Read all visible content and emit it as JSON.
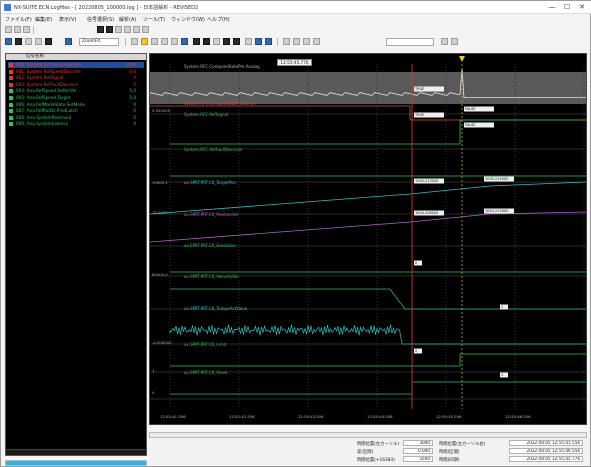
{
  "window": {
    "title": "NX-SUITE ECN Logfiles - [ 20220805_100000.log ] - 日本語解析 - REVISED2",
    "min": "—",
    "max": "☐",
    "close": "✕"
  },
  "menu": [
    "ファイル(F)",
    "編集(E)",
    "表示(V)",
    "信号選択(S)",
    "解析(A)",
    "ツール(T)",
    "ウィンドウ(W)",
    "ヘルプ(H)"
  ],
  "toolbar": {
    "combo_value": "ZoomFit"
  },
  "signal_list": {
    "header": "信号名称",
    "items": [
      {
        "name": "000: System.RefComputeState",
        "value": "1000",
        "color": "#ff3030",
        "selected": true
      },
      {
        "name": "001: System.RefSpeedDiscrete",
        "value": "0.0",
        "color": "#ff3030"
      },
      {
        "name": "002: System.RefSignal",
        "value": "0",
        "color": "#d63b3b"
      },
      {
        "name": "003: System.RefFaultDecision",
        "value": "0",
        "color": "#d63b3b"
      },
      {
        "name": "004: Ana.RefSpeed.SetterVal",
        "value": "5.0",
        "color": "#30c060"
      },
      {
        "name": "005: Ana.RefSpeed.Target",
        "value": "5.0",
        "color": "#30c060"
      },
      {
        "name": "006: Ana.RefModeState.SetMode",
        "value": "0",
        "color": "#30c060"
      },
      {
        "name": "007: Ana.RefRotDir.ProdLatch",
        "value": "0",
        "color": "#30c060"
      },
      {
        "name": "008: Ana.SystemReserved",
        "value": "0",
        "color": "#30c060"
      },
      {
        "name": "009: Ana.SystemLatency",
        "value": "0",
        "color": "#30c060"
      }
    ]
  },
  "plot": {
    "cursor_popup": "12:55:45.776",
    "traces": [
      {
        "label": "System.RFC.ComputeStatePre.Analog",
        "color": "#b0b0b0"
      },
      {
        "label": "System.RFC.ComputeState.Boolean",
        "color": "#d05050"
      },
      {
        "label": "System.RFC.RefSignal",
        "color": "#30c060"
      },
      {
        "label": "System.RFC.RefFaultDecision",
        "color": "#30c060"
      },
      {
        "label": "ax.SPRT.PRT.Ctl_TargetPos",
        "color": "#30c0c0"
      },
      {
        "label": "ax.SPRT.PRT.Ctl_PositionVal",
        "color": "#b060d0"
      },
      {
        "label": "ax.SPRT.PRT.Ctl_Execution",
        "color": "#30c060"
      },
      {
        "label": "ax.SPRT.PRT.Ctl_VelocityVal",
        "color": "#30c060"
      },
      {
        "label": "ax.SPRT.PRT.Ctl_TorqueActValue",
        "color": "#30c0c0"
      },
      {
        "label": "ax.SPRT.PRT.Ctl_Limit",
        "color": "#30c060"
      },
      {
        "label": "ax.SPRT.PRT.Ctl_Reset",
        "color": "#30c060"
      }
    ],
    "left_labels": [
      "5.000000",
      "10000.1",
      "10.0001",
      "80000.0",
      "-4.000000",
      "1",
      "0"
    ],
    "value_tags": [
      "TRUE",
      "FALSE",
      "TRUE",
      "FALSE",
      "1005.213000",
      "1005.219000",
      "1004.208000",
      "1004.213000",
      "0",
      "1",
      "0",
      "1"
    ],
    "x_ticks": [
      "12:55:41.556",
      "12:55:42.556",
      "12:55:43.556",
      "12:55:44.556",
      "12:55:45.556",
      "12:55:46.556"
    ]
  },
  "info": {
    "left_labels": [
      "時間位置(左カーソル)",
      "差(区間)"
    ],
    "left_values": [
      "3000",
      "0.000"
    ],
    "right_labels": [
      "時間位置(左カーソル右)",
      "時間(区間)"
    ],
    "right_values": [
      "2022.08.05 12:55:41.556",
      "2022.08.05 12:55:46.556"
    ],
    "row3_labels": [
      "時間位置(+16384)",
      "時間(同期)"
    ],
    "row3_values": [
      "3500",
      "2022.08.05 12:55:45.776"
    ]
  },
  "progress": {
    "value": 1.0
  }
}
